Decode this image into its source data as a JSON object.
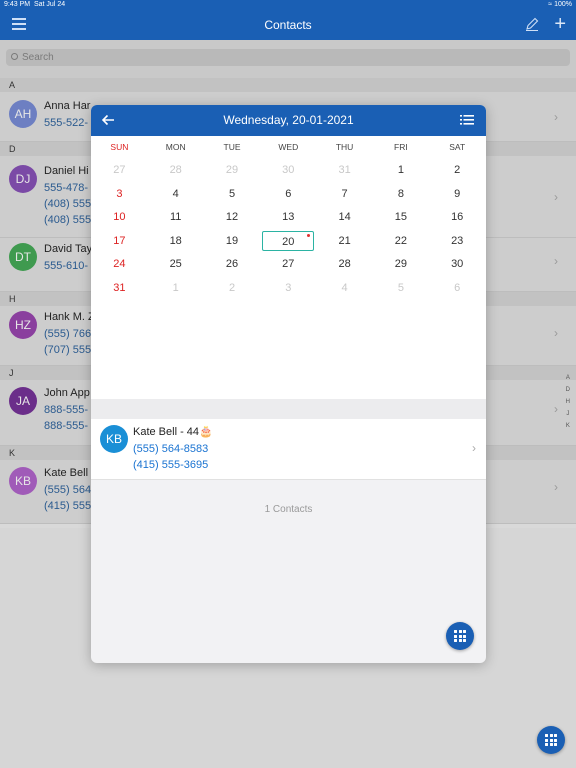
{
  "status": {
    "time": "9:43 PM",
    "date": "Sat Jul 24",
    "battery": "100%"
  },
  "nav": {
    "title": "Contacts"
  },
  "search": {
    "placeholder": "Search"
  },
  "sections": [
    {
      "letter": "A",
      "contacts": [
        {
          "initials": "AH",
          "name": "Anna Har",
          "phones": [
            "555-522-"
          ],
          "color": "#6d7fc2"
        }
      ]
    },
    {
      "letter": "D",
      "contacts": [
        {
          "initials": "DJ",
          "name": "Daniel Hi",
          "phones": [
            "555-478-",
            "(408) 555",
            "(408) 555"
          ],
          "color": "#7b4aa6"
        },
        {
          "initials": "DT",
          "name": "David Tay",
          "phones": [
            "555-610-"
          ],
          "color": "#3f9a4f"
        }
      ]
    },
    {
      "letter": "H",
      "contacts": [
        {
          "initials": "HZ",
          "name": "Hank M. Z",
          "phones": [
            "(555) 766",
            "(707) 555"
          ],
          "color": "#8a3f9e"
        }
      ]
    },
    {
      "letter": "J",
      "contacts": [
        {
          "initials": "JA",
          "name": "John App",
          "phones": [
            "888-555-",
            "888-555-"
          ],
          "color": "#6b2e8a"
        }
      ]
    },
    {
      "letter": "K",
      "contacts": [
        {
          "initials": "KB",
          "name": "Kate Bell",
          "phones": [
            "(555) 564",
            "(415) 555"
          ],
          "color": "#a05bb8"
        }
      ]
    }
  ],
  "index_letters": [
    "A",
    "D",
    "H",
    "J",
    "K"
  ],
  "modal": {
    "title": "Wednesday, 20-01-2021",
    "weekdays": [
      "SUN",
      "MON",
      "TUE",
      "WED",
      "THU",
      "FRI",
      "SAT"
    ],
    "weeks": [
      [
        "27",
        "28",
        "29",
        "30",
        "31",
        "1",
        "2"
      ],
      [
        "3",
        "4",
        "5",
        "6",
        "7",
        "8",
        "9"
      ],
      [
        "10",
        "11",
        "12",
        "13",
        "14",
        "15",
        "16"
      ],
      [
        "17",
        "18",
        "19",
        "20",
        "21",
        "22",
        "23"
      ],
      [
        "24",
        "25",
        "26",
        "27",
        "28",
        "29",
        "30"
      ],
      [
        "31",
        "1",
        "2",
        "3",
        "4",
        "5",
        "6"
      ]
    ],
    "selected_day": "20",
    "contact": {
      "initials": "KB",
      "name": "Kate Bell - 44🎂",
      "phones": [
        "(555) 564-8583",
        "(415) 555-3695"
      ]
    },
    "count_label": "1 Contacts"
  },
  "colors": {
    "accent": "#1a5fb4",
    "sunday": "#dd2222",
    "selected_border": "#2bb3a3",
    "phone_link": "#1a73d1"
  }
}
